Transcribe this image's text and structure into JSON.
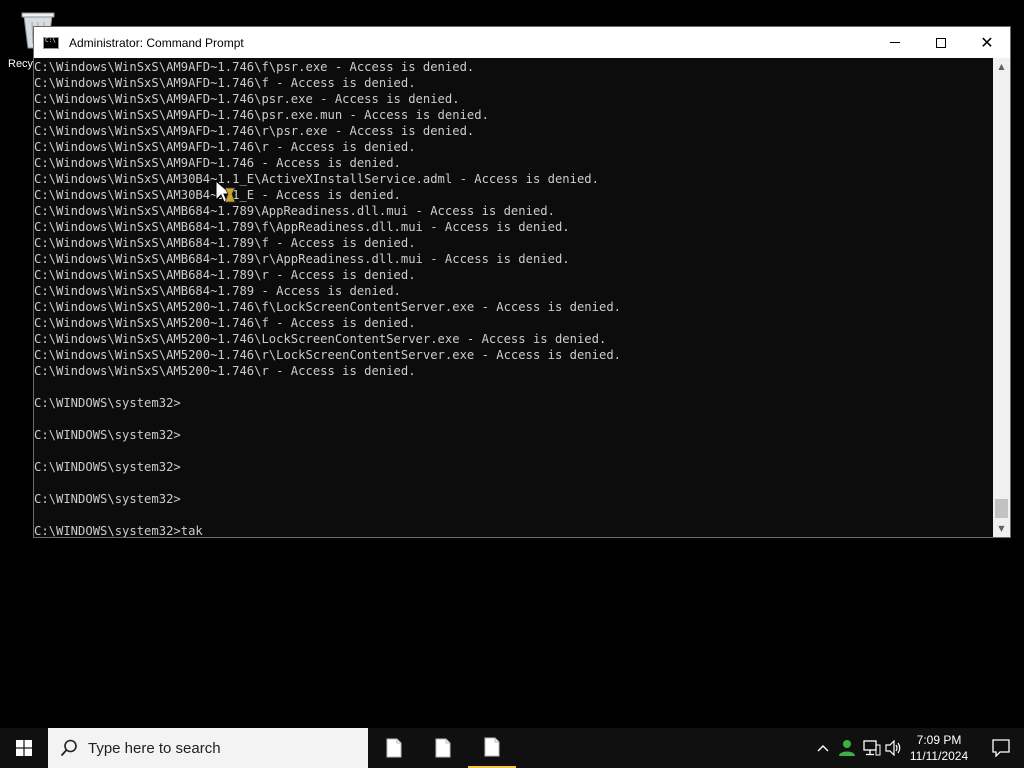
{
  "desktop": {
    "recycle_bin_label": "Recyc"
  },
  "window": {
    "title": "Administrator: Command Prompt",
    "lines": [
      "C:\\Windows\\WinSxS\\AM9AFD~1.746\\f\\psr.exe - Access is denied.",
      "C:\\Windows\\WinSxS\\AM9AFD~1.746\\f - Access is denied.",
      "C:\\Windows\\WinSxS\\AM9AFD~1.746\\psr.exe - Access is denied.",
      "C:\\Windows\\WinSxS\\AM9AFD~1.746\\psr.exe.mun - Access is denied.",
      "C:\\Windows\\WinSxS\\AM9AFD~1.746\\r\\psr.exe - Access is denied.",
      "C:\\Windows\\WinSxS\\AM9AFD~1.746\\r - Access is denied.",
      "C:\\Windows\\WinSxS\\AM9AFD~1.746 - Access is denied.",
      "C:\\Windows\\WinSxS\\AM30B4~1.1_E\\ActiveXInstallService.adml - Access is denied.",
      "C:\\Windows\\WinSxS\\AM30B4~1.1_E - Access is denied.",
      "C:\\Windows\\WinSxS\\AMB684~1.789\\AppReadiness.dll.mui - Access is denied.",
      "C:\\Windows\\WinSxS\\AMB684~1.789\\f\\AppReadiness.dll.mui - Access is denied.",
      "C:\\Windows\\WinSxS\\AMB684~1.789\\f - Access is denied.",
      "C:\\Windows\\WinSxS\\AMB684~1.789\\r\\AppReadiness.dll.mui - Access is denied.",
      "C:\\Windows\\WinSxS\\AMB684~1.789\\r - Access is denied.",
      "C:\\Windows\\WinSxS\\AMB684~1.789 - Access is denied.",
      "C:\\Windows\\WinSxS\\AM5200~1.746\\f\\LockScreenContentServer.exe - Access is denied.",
      "C:\\Windows\\WinSxS\\AM5200~1.746\\f - Access is denied.",
      "C:\\Windows\\WinSxS\\AM5200~1.746\\LockScreenContentServer.exe - Access is denied.",
      "C:\\Windows\\WinSxS\\AM5200~1.746\\r\\LockScreenContentServer.exe - Access is denied.",
      "C:\\Windows\\WinSxS\\AM5200~1.746\\r - Access is denied.",
      "",
      "C:\\WINDOWS\\system32>",
      "",
      "C:\\WINDOWS\\system32>",
      "",
      "C:\\WINDOWS\\system32>",
      "",
      "C:\\WINDOWS\\system32>",
      "",
      "C:\\WINDOWS\\system32>tak"
    ]
  },
  "taskbar": {
    "search_placeholder": "Type here to search",
    "time": "7:09 PM",
    "date": "11/11/2024"
  },
  "colors": {
    "console_bg": "#0c0c0c",
    "console_text": "#cccccc",
    "taskbar_bg": "#101010",
    "active_indicator": "#f5c44b"
  }
}
